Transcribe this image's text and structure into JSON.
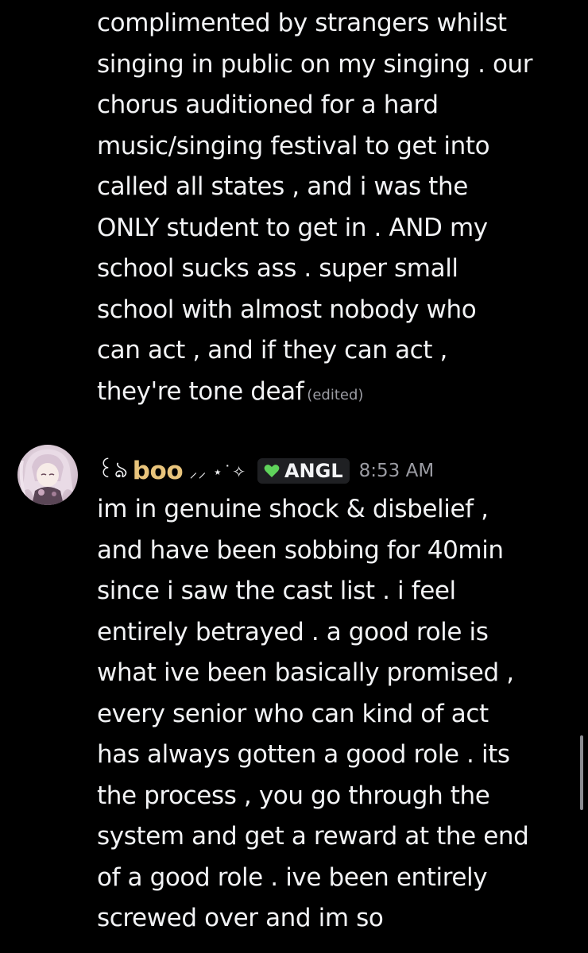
{
  "message_continuation": {
    "text": "complimented by strangers whilst\nsinging in public on my singing . our\nchorus auditioned for a hard\nmusic/singing festival to get into\ncalled all states , and i was the\nONLY student to get in . AND my\nschool sucks ass . super small\nschool with almost nobody who\ncan act , and if they can act ,\nthey're tone deaf",
    "edited_label": "(edited)"
  },
  "message": {
    "author_prefix": "꒰ঌ",
    "author": "boo",
    "author_decoration": "⸝⸝ ⋆˙✧",
    "guild_tag": "ANGL",
    "timestamp": "8:53 AM",
    "text": "im in genuine shock & disbelief ,\nand have been sobbing for 40min\nsince i saw the cast list . i feel\nentirely betrayed . a good role is\nwhat ive been basically promised ,\nevery senior who can kind of act\nhas always gotten a good role . its\nthe process , you go through the\nsystem and get a reward at the end\nof a good role . ive been entirely\nscrewed over and im so"
  },
  "colors": {
    "background": "#000000",
    "text": "#f2f3f5",
    "username": "#e8c47c",
    "muted": "#9b9ca3",
    "tag_heart": "#5fd35b",
    "tag_bg": "#1f2023"
  },
  "icons": {
    "guild_tag_icon": "green-heart-icon",
    "avatar": "anime-character-avatar"
  }
}
